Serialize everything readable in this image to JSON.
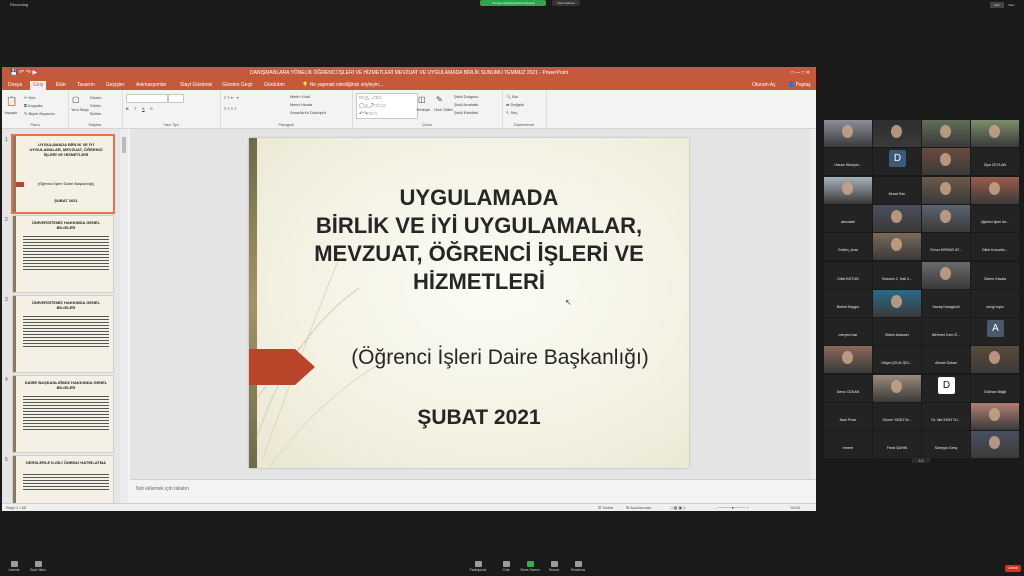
{
  "zoom": {
    "recording_label": "Recording",
    "sharing_banner": "You are viewing [shared screen]",
    "view_options": "View Options",
    "exit_label": "Exit",
    "view_label": "View",
    "leave_label": "Leave",
    "toolbar": [
      {
        "label": "Unmute",
        "icon": "microphone-icon"
      },
      {
        "label": "Start Video",
        "icon": "camera-icon"
      },
      {
        "label": "Participants",
        "icon": "participants-icon"
      },
      {
        "label": "Chat",
        "icon": "chat-icon"
      },
      {
        "label": "Share Screen",
        "icon": "share-screen-icon"
      },
      {
        "label": "Record",
        "icon": "record-icon"
      },
      {
        "label": "Reactions",
        "icon": "reactions-icon"
      }
    ]
  },
  "ppt": {
    "window_title": "DANIŞMANLARA YÖNELİK ÖĞRENCİ İŞLERİ VE HİZMETLERİ MEVZUAT VE UYGULAMADA BİRLİK SUNUMU TEMMUZ 2021 - PowerPoint",
    "tabs": [
      "Dosya",
      "Giriş",
      "Ekle",
      "Tasarım",
      "Geçişler",
      "Animasyonlar",
      "Slayt Gösterisi",
      "Gözden Geçir",
      "Görünüm"
    ],
    "search_hint": "Ne yapmak istediğinizi söyleyin...",
    "user": "Oturum Aç",
    "share": "Paylaş",
    "ribbon": {
      "clipboard": {
        "paste": "Yapıştır",
        "cut": "Kes",
        "copy": "Kopyala",
        "format_painter": "Biçim Boyacısı",
        "label": "Pano"
      },
      "slides": {
        "new_slide": "Yeni Slayt",
        "layout": "Düzen",
        "reset": "Sıfırla",
        "section": "Bölüm",
        "label": "Slaytlar"
      },
      "font": {
        "label": "Yazı Tipi",
        "bold": "K",
        "italic": "T",
        "underline": "A",
        "shadow": "S"
      },
      "paragraph": {
        "label": "Paragraf",
        "text_direction": "Metin Yönü",
        "align_text": "Metni Hizala",
        "smartart": "SmartArt'a Dönüştür"
      },
      "drawing": {
        "label": "Çizim",
        "arrange": "Yerleştir",
        "quick_styles": "Hızlı Stiller",
        "fill": "Şekil Dolgusu",
        "outline": "Şekil Anahattı",
        "effects": "Şekil Efektleri"
      },
      "editing": {
        "label": "Düzenleme",
        "find": "Bul",
        "replace": "Değiştir",
        "select": "Seç"
      }
    },
    "slide": {
      "title_lines": [
        "UYGULAMADA",
        "BİRLİK VE İYİ UYGULAMALAR,",
        "MEVZUAT, ÖĞRENCİ İŞLERİ VE",
        "HİZMETLERİ"
      ],
      "subtitle": "(Öğrenci İşleri Daire Başkanlığı)",
      "date": "ŞUBAT 2021"
    },
    "thumbnails": [
      {
        "num": "1",
        "title": "UYGULAMADA BİRLİK VE İYİ UYGULAMALAR, MEVZUAT, ÖĞRENCİ İŞLERİ VE HİZMETLERİ",
        "sub": "(Öğrenci İşleri Daire Başkanlığı)",
        "date": "ŞUBAT 2021"
      },
      {
        "num": "2",
        "title": "ÜNİVERSİTEMİZ HAKKINDA GENEL BİLGİLER"
      },
      {
        "num": "3",
        "title": "ÜNİVERSİTEMİZ HAKKINDA GENEL BİLGİLER"
      },
      {
        "num": "4",
        "title": "DAİRE BAŞKANLIĞIMIZ HAKKINDA GENEL BİLGİLER"
      },
      {
        "num": "5",
        "title": "DERSLERLE İLGİLİ ÖNEMLİ HATIRLATMA"
      }
    ],
    "notes_placeholder": "Not eklemek için tıklatın",
    "status": {
      "slide_counter": "Slayt 1 / 65",
      "notes": "Notlar",
      "comments": "Açıklamalar",
      "zoom": "%100"
    }
  },
  "participants": [
    {
      "name": "",
      "video": true,
      "tone": "#8a8f99"
    },
    {
      "name": "",
      "video": true,
      "tone": "#2e2e2e"
    },
    {
      "name": "",
      "video": true,
      "tone": "#5f6e58"
    },
    {
      "name": "",
      "video": true,
      "tone": "#7c8e6a",
      "speaking": true
    },
    {
      "name": "Hasan Hüseyin...",
      "video": false
    },
    {
      "name": "",
      "avatar": "D",
      "avatar_color": "#3b5a7a"
    },
    {
      "name": "",
      "video": true,
      "tone": "#6a4b3f"
    },
    {
      "name": "Ziya CEYLAN",
      "video": false
    },
    {
      "name": "",
      "video": true,
      "tone": "#a9b0b8"
    },
    {
      "name": "Murat Sarı",
      "video": false
    },
    {
      "name": "",
      "video": true,
      "tone": "#6d5a4a"
    },
    {
      "name": "",
      "video": true,
      "tone": "#9b5b4c"
    },
    {
      "name": "abeuiwei",
      "video": false
    },
    {
      "name": "",
      "video": true,
      "tone": "#4a4f5a"
    },
    {
      "name": "",
      "video": true,
      "tone": "#5b6470"
    },
    {
      "name": "öğrenci işleri de...",
      "video": false
    },
    {
      "name": "Gulten_Acar",
      "video": false
    },
    {
      "name": "",
      "video": true,
      "tone": "#7a6a5a"
    },
    {
      "name": "Öznur KIRMIZI AT...",
      "video": false
    },
    {
      "name": "Dilek Kuvvetlo...",
      "video": false
    },
    {
      "name": "Dilek BÜTÜN",
      "video": false
    },
    {
      "name": "Session 2, Hall 2...",
      "video": false
    },
    {
      "name": "",
      "video": true,
      "tone": "#6a6a6a"
    },
    {
      "name": "Gizem Kavala",
      "video": false
    },
    {
      "name": "Bulent Kaygın",
      "video": false
    },
    {
      "name": "",
      "video": true,
      "tone": "#2a6a8a"
    },
    {
      "name": "Savaş Karagözlü",
      "video": false
    },
    {
      "name": "sevgi toplu",
      "video": false
    },
    {
      "name": "meryem kar",
      "video": false
    },
    {
      "name": "İlkben Akansel",
      "video": false
    },
    {
      "name": "Mehmet Cem Ö...",
      "video": false
    },
    {
      "name": "",
      "avatar": "A",
      "avatar_color": "#4a5a6a"
    },
    {
      "name": "",
      "video": true,
      "tone": "#8a6a5a"
    },
    {
      "name": "Hülya ÇELİK ŞEL...",
      "video": false
    },
    {
      "name": "Ahmet Özkan",
      "video": false
    },
    {
      "name": "",
      "video": true,
      "tone": "#5a4a3a"
    },
    {
      "name": "Deniz ÖZKAN",
      "video": false
    },
    {
      "name": "",
      "video": true,
      "tone": "#9a8a7a"
    },
    {
      "name": "",
      "avatar": "D",
      "avatar_color": "#ffffff",
      "avatar_text": "#111111"
    },
    {
      "name": "Gökhan Bilgili",
      "video": false
    },
    {
      "name": "Nazi Pınar",
      "video": false
    },
    {
      "name": "Gözen YAĞIZ M...",
      "video": false
    },
    {
      "name": "Dr. İlke EKİN TU...",
      "video": false
    },
    {
      "name": "",
      "video": true,
      "tone": "#b08070"
    },
    {
      "name": "emere",
      "video": false
    },
    {
      "name": "Ferat ŞAHİN",
      "video": false
    },
    {
      "name": "Süreyya Genç",
      "video": false
    },
    {
      "name": "",
      "video": true,
      "tone": "#4a5060"
    }
  ],
  "gallery_page": "1/2"
}
